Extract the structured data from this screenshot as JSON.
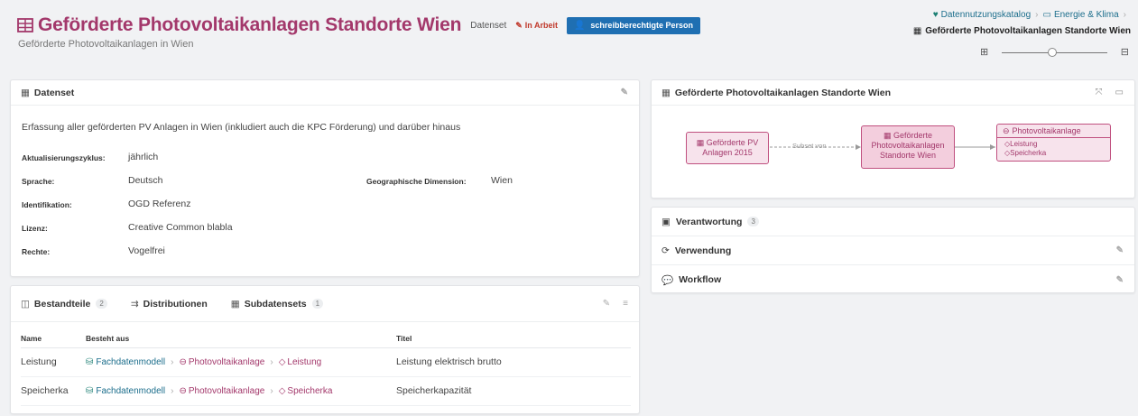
{
  "header": {
    "title": "Geförderte Photovoltaikanlagen Standorte Wien",
    "type_label": "Datenset",
    "status_label": "In Arbeit",
    "badge_label": "schreibberechtigte Person",
    "subtitle": "Geförderte Photovoltaikanlagen in Wien",
    "accent_color": "#a3386b",
    "badge_color": "#1f6fb2"
  },
  "breadcrumb": {
    "items": [
      "Datennutzungskatalog",
      "Energie & Klima"
    ],
    "current": "Geförderte Photovoltaikanlagen Standorte Wien"
  },
  "datenset": {
    "heading": "Datenset",
    "description": "Erfassung aller geförderten PV Anlagen in Wien (inkludiert auch die KPC Förderung) und darüber hinaus",
    "props": [
      {
        "key": "Aktualisierungszyklus:",
        "value": "jährlich"
      },
      {
        "key": "Sprache:",
        "value": "Deutsch"
      },
      {
        "key": "Identifikation:",
        "value": "OGD Referenz"
      },
      {
        "key": "Lizenz:",
        "value": "Creative Common blabla"
      },
      {
        "key": "Rechte:",
        "value": "Vogelfrei"
      }
    ],
    "geo": {
      "key": "Geographische Dimension:",
      "value": "Wien"
    }
  },
  "bestandteile": {
    "tabs": [
      {
        "label": "Bestandteile",
        "count": "2"
      },
      {
        "label": "Distributionen",
        "count": ""
      },
      {
        "label": "Subdatensets",
        "count": "1"
      }
    ],
    "columns": [
      "Name",
      "Besteht aus",
      "Titel"
    ],
    "rows": [
      {
        "name": "Leistung",
        "model": "Fachdatenmodell",
        "entity": "Photovoltaikanlage",
        "attr": "Leistung",
        "title": "Leistung elektrisch brutto"
      },
      {
        "name": "Speicherka",
        "model": "Fachdatenmodell",
        "entity": "Photovoltaikanlage",
        "attr": "Speicherka",
        "title": "Speicherkapazität"
      }
    ]
  },
  "graph": {
    "heading": "Geförderte Photovoltaikanlagen Standorte Wien",
    "node_left": "Geförderte PV Anlagen 2015",
    "edge_label": "Subset von",
    "node_center": "Geförderte Photovoltaikanlagen Standorte Wien",
    "node_entity": "Photovoltaikanlage",
    "entity_attrs": [
      "Leistung",
      "Speicherka"
    ]
  },
  "side": {
    "rows": [
      {
        "label": "Verantwortung",
        "count": "3"
      },
      {
        "label": "Verwendung"
      },
      {
        "label": "Workflow"
      }
    ]
  }
}
